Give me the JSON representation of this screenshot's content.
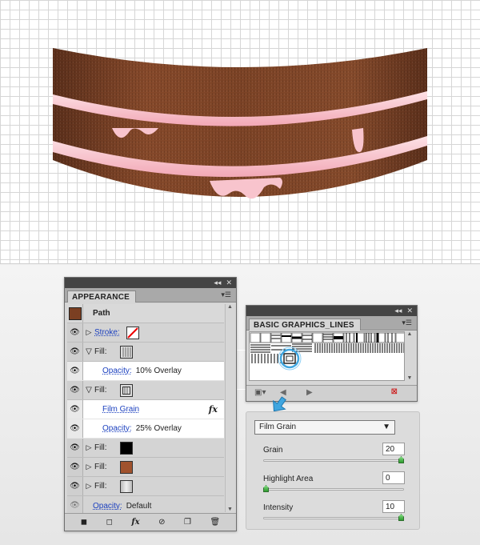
{
  "appearance": {
    "title": "APPEARANCE",
    "header_label": "Path",
    "rows": [
      {
        "type": "stroke",
        "label": "Stroke:",
        "swatch": "none"
      },
      {
        "type": "fill",
        "label": "Fill:",
        "expanded": true,
        "swatch": "pattern"
      },
      {
        "type": "opacity",
        "label": "Opacity:",
        "value": "10% Overlay"
      },
      {
        "type": "fill",
        "label": "Fill:",
        "expanded": true,
        "swatch": "pattern-selected"
      },
      {
        "type": "effect",
        "label": "Film Grain",
        "fx": "fx"
      },
      {
        "type": "opacity",
        "label": "Opacity:",
        "value": "25% Overlay"
      },
      {
        "type": "fill",
        "label": "Fill:",
        "swatch": "#000000"
      },
      {
        "type": "fill",
        "label": "Fill:",
        "swatch": "#a0522d"
      },
      {
        "type": "fill",
        "label": "Fill:",
        "swatch": "gray-gradient"
      },
      {
        "type": "opacity",
        "label": "Opacity:",
        "value": "Default"
      }
    ],
    "footer_icons": [
      "new-art-icon",
      "new-stroke-icon",
      "fx-icon",
      "clear-icon",
      "duplicate-icon",
      "trash-icon"
    ],
    "fx_label": "fx"
  },
  "lines_panel": {
    "title": "BASIC GRAPHICS_LINES"
  },
  "film_grain": {
    "effect": "Film Grain",
    "grain_label": "Grain",
    "grain_value": "20",
    "grain_level": 1.0,
    "highlight_label": "Highlight Area",
    "highlight_value": "0",
    "highlight_level": 0.0,
    "intensity_label": "Intensity",
    "intensity_value": "10",
    "intensity_level": 1.0
  },
  "colors": {
    "cake_brown": "#7a4328",
    "cream": "#f6c3cc",
    "accent_blue": "#3fa6e0"
  }
}
